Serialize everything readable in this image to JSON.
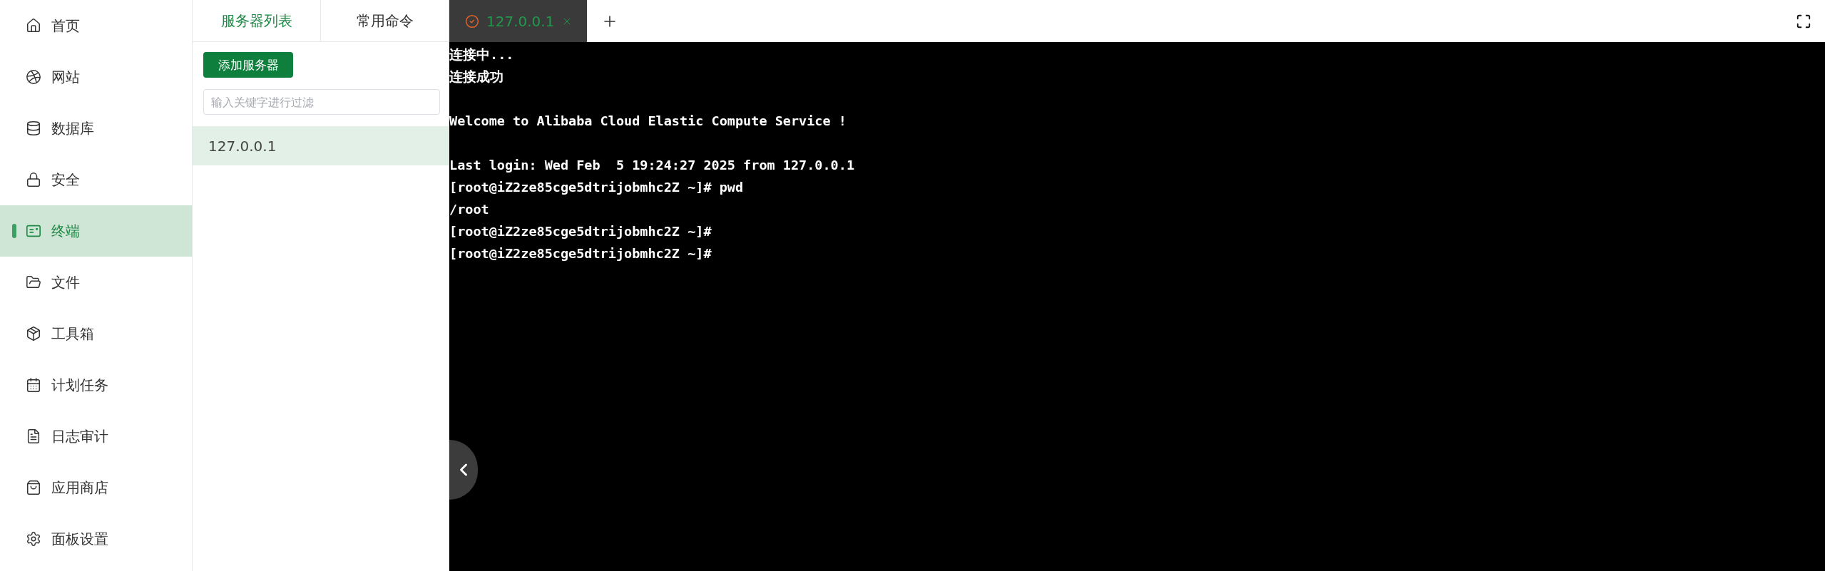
{
  "sidebar": {
    "items": [
      {
        "label": "首页",
        "kind": "home",
        "selected": false
      },
      {
        "label": "网站",
        "kind": "site",
        "selected": false
      },
      {
        "label": "数据库",
        "kind": "database",
        "selected": false
      },
      {
        "label": "安全",
        "kind": "security",
        "selected": false
      },
      {
        "label": "终端",
        "kind": "terminal",
        "selected": true
      },
      {
        "label": "文件",
        "kind": "files",
        "selected": false
      },
      {
        "label": "工具箱",
        "kind": "toolbox",
        "selected": false
      },
      {
        "label": "计划任务",
        "kind": "cron",
        "selected": false
      },
      {
        "label": "日志审计",
        "kind": "logs",
        "selected": false
      },
      {
        "label": "应用商店",
        "kind": "store",
        "selected": false
      },
      {
        "label": "面板设置",
        "kind": "settings",
        "selected": false
      }
    ]
  },
  "server_panel": {
    "tabs": [
      {
        "label": "服务器列表",
        "selected": true
      },
      {
        "label": "常用命令",
        "selected": false
      }
    ],
    "add_button": "添加服务器",
    "filter": {
      "placeholder": "输入关键字进行过滤"
    },
    "servers": [
      {
        "label": "127.0.0.1",
        "selected": true
      }
    ]
  },
  "terminal": {
    "tabs": [
      {
        "label": "127.0.0.1",
        "connected": true,
        "selected": true
      }
    ],
    "output": "连接中...\n连接成功\n\nWelcome to Alibaba Cloud Elastic Compute Service !\n\nLast login: Wed Feb  5 19:24:27 2025 from 127.0.0.1\n[root@iZ2ze85cge5dtrijobmhc2Z ~]# pwd\n/root\n[root@iZ2ze85cge5dtrijobmhc2Z ~]#\n[root@iZ2ze85cge5dtrijobmhc2Z ~]#"
  }
}
